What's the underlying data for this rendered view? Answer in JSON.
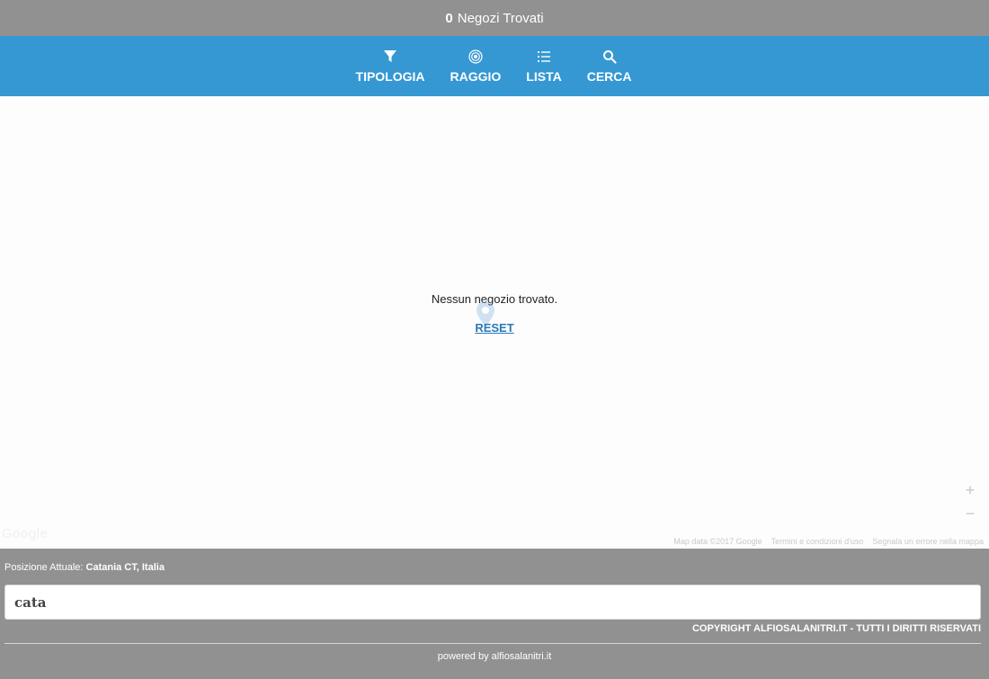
{
  "header": {
    "count": "0",
    "title_text": "Negozi Trovati"
  },
  "nav": {
    "items": [
      {
        "label": "TIPOLOGIA",
        "icon": "filter-icon"
      },
      {
        "label": "RAGGIO",
        "icon": "radius-icon"
      },
      {
        "label": "LISTA",
        "icon": "list-icon"
      },
      {
        "label": "CERCA",
        "icon": "search-icon"
      }
    ]
  },
  "map": {
    "empty_message": "Nessun negozio trovato.",
    "reset_label": "RESET",
    "zoom_in": "+",
    "zoom_out": "−",
    "google_logo": "Google",
    "attribution": {
      "map_data": "Map data ©2017 Google",
      "terms": "Termini e condizioni d'uso",
      "report": "Segnala un errore nella mappa"
    }
  },
  "footer": {
    "position_label": "Posizione Attuale:",
    "position_value": "Catania CT, Italia",
    "search_value": "cata",
    "copyright": "COPYRIGHT ALFIOSALANITRI.IT - TUTTI I DIRITTI RISERVATI",
    "powered_by": "powered by alfiosalanitri.it"
  },
  "colors": {
    "gray_bar": "#919191",
    "nav_blue": "#3598d3",
    "link_blue": "#2a7ab8"
  }
}
